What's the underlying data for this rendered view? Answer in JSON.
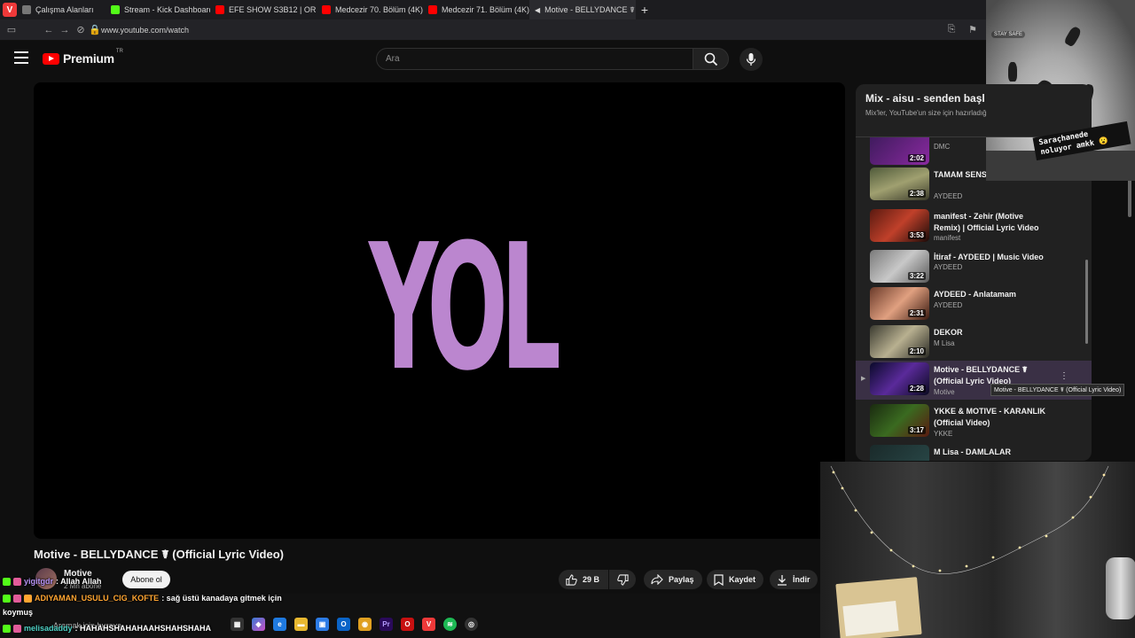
{
  "browser": {
    "tabs": [
      {
        "label": "Çalışma Alanları",
        "color": "#777777"
      },
      {
        "label": "Stream - Kick Dashboard",
        "color": "#53fc18"
      },
      {
        "label": "EFE SHOW S3B12 | ORKUN",
        "color": "#ff0000"
      },
      {
        "label": "Medcezir 70. Bölüm (4K) - Y",
        "color": "#ff0000"
      },
      {
        "label": "Medcezir 71. Bölüm (4K) - Y",
        "color": "#ff0000"
      },
      {
        "label": "Motive - BELLYDANCE ☤ (O",
        "color": "#ffffff"
      }
    ],
    "url": "www.youtube.com/watch"
  },
  "youtube": {
    "brand": "Premium",
    "region": "TR",
    "search_placeholder": "Ara"
  },
  "player": {
    "overlay_text": "YOL"
  },
  "video": {
    "title": "Motive - BELLYDANCE ☤ (Official Lyric Video)",
    "channel": "Motive",
    "subscribers": "2 Mn abone",
    "subscribe_label": "Abone ol",
    "like_count": "29 B",
    "share_label": "Paylaş",
    "save_label": "Kaydet",
    "download_label": "İndir"
  },
  "playlist": {
    "title": "Mix - aisu - senden başl",
    "subtitle": "Mix'ler, YouTube'un size için hazırladığ",
    "items": [
      {
        "title": "",
        "channel": "DMC",
        "duration": "2:02"
      },
      {
        "title": "TAMAM SENS Music Video",
        "channel": "AYDEED",
        "duration": "2:38"
      },
      {
        "title": "manifest - Zehir (Motive Remix) | Official Lyric Video",
        "channel": "manifest",
        "duration": "3:53"
      },
      {
        "title": "İtiraf - AYDEED | Music Video",
        "channel": "AYDEED",
        "duration": "3:22"
      },
      {
        "title": "AYDEED - Anlatamam",
        "channel": "AYDEED",
        "duration": "2:31"
      },
      {
        "title": "DEKOR",
        "channel": "M Lisa",
        "duration": "2:10"
      },
      {
        "title": "Motive - BELLYDANCE ☤ (Official Lyric Video)",
        "channel": "Motive",
        "duration": "2:28"
      },
      {
        "title": "YKKE & MOTIVE - KARANLIK (Official Video)",
        "channel": "YKKE",
        "duration": "3:17"
      },
      {
        "title": "M Lisa - DAMLALAR",
        "channel": "",
        "duration": ""
      }
    ],
    "tooltip": "Motive - BELLYDANCE ☤ (Official Lyric Video)"
  },
  "overlay": {
    "stay_safe": "STAY SAFE",
    "caption": "Saraçhanede noluyor amkk 😮"
  },
  "chat": [
    {
      "user": "yigitgdr",
      "message": ": Allah Allah"
    },
    {
      "user": "ADIYAMAN_USULU_CIG_KOFTE",
      "message": ": sağ üstü kanadaya gitmek için"
    },
    {
      "user": "melisadaddy",
      "message": ": HAHAHSHAHAHAAHSHAHSHAHA"
    }
  ],
  "chat_continuation": "koymuş",
  "taskbar": {
    "search_placeholder": "Aramak için buraya"
  }
}
